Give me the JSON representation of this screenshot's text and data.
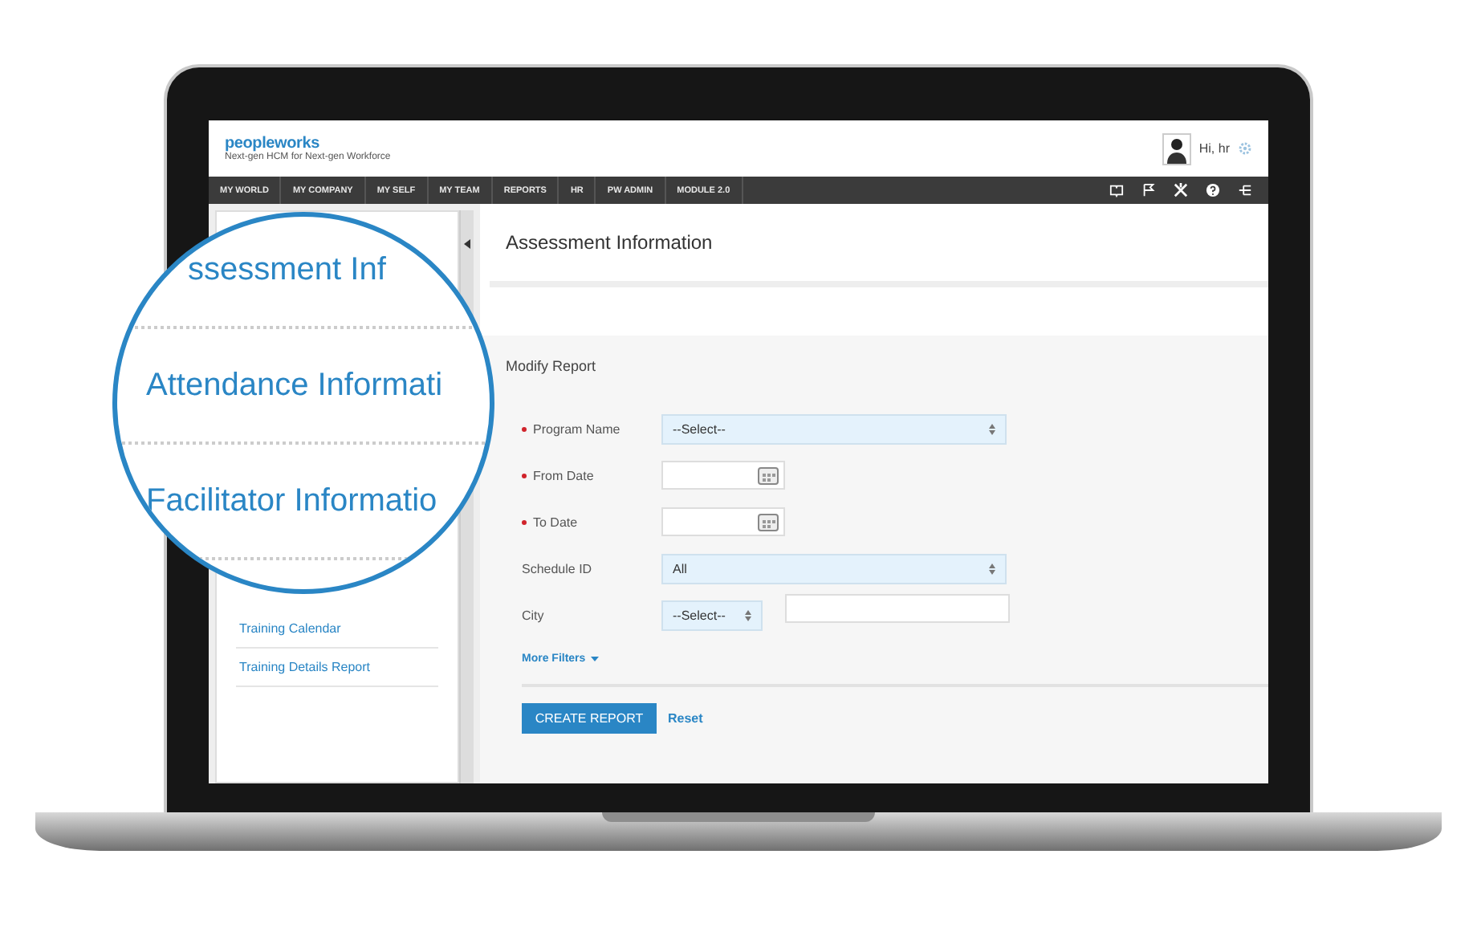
{
  "header": {
    "logo": "peopleworks",
    "tagline": "Next-gen HCM for Next-gen Workforce",
    "greeting": "Hi, hr"
  },
  "nav": {
    "items": [
      {
        "label": "MY WORLD"
      },
      {
        "label": "MY COMPANY"
      },
      {
        "label": "MY SELF"
      },
      {
        "label": "MY TEAM"
      },
      {
        "label": "REPORTS"
      },
      {
        "label": "HR"
      },
      {
        "label": "PW ADMIN"
      },
      {
        "label": "MODULE 2.0"
      }
    ]
  },
  "sidebar": {
    "items": [
      {
        "label": "Training Calendar"
      },
      {
        "label": "Training Details Report"
      }
    ]
  },
  "magnifier": {
    "items": [
      {
        "label": "ssessment Inf"
      },
      {
        "label": "Attendance Informati"
      },
      {
        "label": "Facilitator Informatio"
      }
    ]
  },
  "page_title": "Assessment Information",
  "form": {
    "title": "Modify Report",
    "fields": [
      {
        "kind": "select",
        "label": "Program Name",
        "required": true,
        "value": "--Select--"
      },
      {
        "kind": "date",
        "label": "From Date",
        "required": true
      },
      {
        "kind": "date",
        "label": "To Date",
        "required": true
      },
      {
        "kind": "select",
        "label": "Schedule ID",
        "required": false,
        "value": "All"
      },
      {
        "kind": "city",
        "label": "City",
        "required": false,
        "value": "--Select--"
      }
    ],
    "more_filters": "More Filters",
    "submit": "CREATE REPORT",
    "reset": "Reset"
  }
}
